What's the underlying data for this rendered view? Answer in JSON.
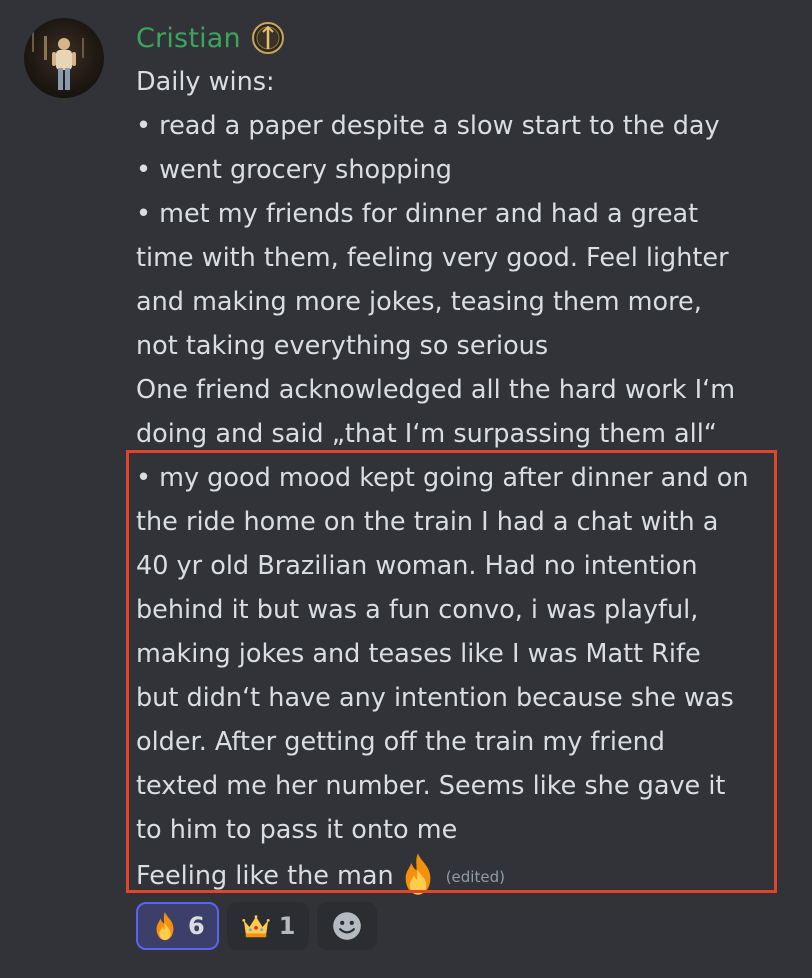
{
  "author": {
    "name": "Cristian",
    "avatar_icon": "user-avatar",
    "badge_icon": "role-badge-icon",
    "name_color": "#3ba55c"
  },
  "message": {
    "lines": [
      "Daily wins:",
      "• read a paper despite a slow start to the day",
      "• went grocery shopping",
      "• met my friends for dinner and had a great",
      "time with them, feeling very good. Feel lighter",
      "and making more jokes, teasing them more,",
      "not taking everything so serious",
      "One friend acknowledged all the hard work I‘m",
      "doing and said „that I‘m surpassing them all“",
      "• my good mood kept going after dinner and on",
      "the ride home on the train I had a chat with a",
      "40 yr old Brazilian woman. Had no intention",
      "behind it but was a fun convo, i was playful,",
      "making jokes and teases like I was Matt Rife",
      "but didn‘t have any intention because she was",
      "older. After getting off the train my friend",
      "texted me her number. Seems like she gave it",
      "to him to pass it onto me"
    ],
    "last_line": "Feeling like the man",
    "last_line_emoji": "fire-emoji",
    "edited_label": "(edited)"
  },
  "reactions": [
    {
      "emoji": "fire-emoji",
      "count": "6",
      "active": true
    },
    {
      "emoji": "crown-emoji",
      "count": "1",
      "active": false
    }
  ],
  "add_reaction_icon": "smiley-icon",
  "colors": {
    "background": "#313338",
    "text": "#dbdee1",
    "highlight_border": "#e0452b",
    "active_reaction_border": "#5865f2",
    "active_reaction_bg": "#3c3f6a",
    "muted": "#949ba4"
  }
}
